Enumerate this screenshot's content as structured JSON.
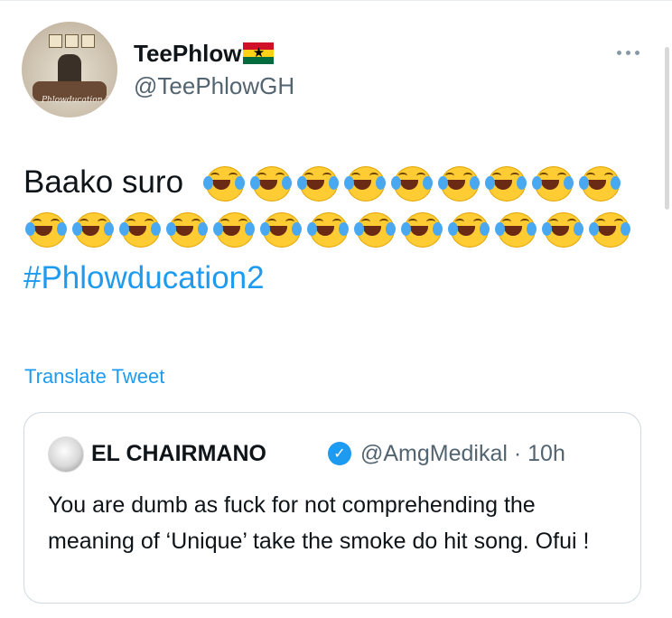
{
  "author": {
    "display_name": "TeePhlow",
    "flag": "Ghana flag emoji",
    "handle": "@TeePhlowGH",
    "avatar_signature": "Phlowducation 2"
  },
  "tweet": {
    "text": "Baako suro",
    "emoji": "face-with-tears-of-joy",
    "emoji_count_line1": 9,
    "emoji_count_line2": 13,
    "hashtag": "#Phlowducation2"
  },
  "actions": {
    "more_icon": "more-horizontal-icon",
    "translate_label": "Translate Tweet"
  },
  "quoted_tweet": {
    "display_name": "EL CHAIRMANO",
    "verified_icon": "verified-badge-icon",
    "handle_time": "@AmgMedikal · 10h",
    "text": "You are dumb as fuck for not comprehending the meaning of ‘Unique’ take the smoke do hit song. Ofui !"
  },
  "colors": {
    "link": "#1d9bf0",
    "secondary_text": "#536471",
    "border": "#cfd9de"
  }
}
